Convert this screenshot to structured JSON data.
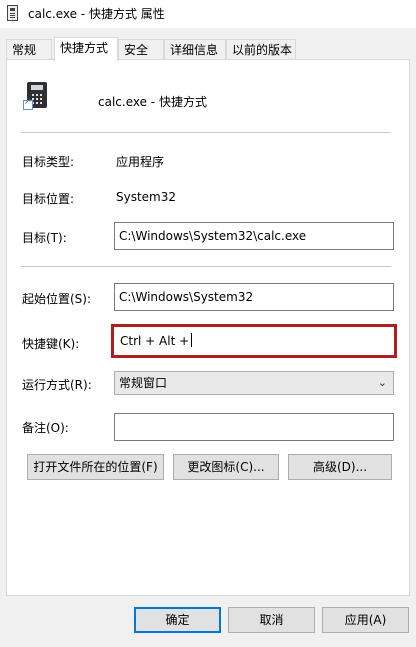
{
  "window": {
    "title": "calc.exe - 快捷方式 属性"
  },
  "tabs": [
    {
      "label": "常规"
    },
    {
      "label": "快捷方式"
    },
    {
      "label": "安全"
    },
    {
      "label": "详细信息"
    },
    {
      "label": "以前的版本"
    }
  ],
  "shortcut": {
    "name": "calc.exe - 快捷方式",
    "target_type_label": "目标类型:",
    "target_type_value": "应用程序",
    "target_location_label": "目标位置:",
    "target_location_value": "System32",
    "target_label": "目标(T):",
    "target_value": "C:\\Windows\\System32\\calc.exe",
    "start_in_label": "起始位置(S):",
    "start_in_value": "C:\\Windows\\System32",
    "hotkey_label": "快捷键(K):",
    "hotkey_value": "Ctrl + Alt +",
    "run_label": "运行方式(R):",
    "run_value": "常规窗口",
    "comment_label": "备注(O):",
    "comment_value": ""
  },
  "actions": {
    "open_location": "打开文件所在的位置(F)",
    "change_icon": "更改图标(C)...",
    "advanced": "高级(D)..."
  },
  "footer": {
    "ok": "确定",
    "cancel": "取消",
    "apply": "应用(A)"
  },
  "colors": {
    "highlight_border": "#b01e1e",
    "default_button_border": "#0078d7"
  }
}
